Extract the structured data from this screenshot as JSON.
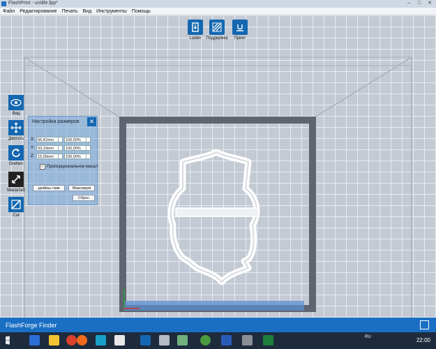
{
  "window": {
    "title": "FlashPrint - untitle.fpp*",
    "controls": [
      "–",
      "□",
      "✕"
    ]
  },
  "menu": [
    "Файл",
    "Редактирование",
    "Печать",
    "Вид",
    "Инструменты",
    "Помощь"
  ],
  "top_tools": [
    {
      "label": "Laden",
      "icon": "load-icon"
    },
    {
      "label": "Поддержка",
      "icon": "support-icon"
    },
    {
      "label": "Принт",
      "icon": "print-icon"
    }
  ],
  "side_tools": [
    {
      "label": "Вид",
      "icon": "eye-icon"
    },
    {
      "label": "Двигать",
      "icon": "move-icon"
    },
    {
      "label": "Drehen",
      "icon": "rotate-icon"
    },
    {
      "label": "Масштаб",
      "icon": "scale-icon",
      "active": true
    },
    {
      "label": "Cut",
      "icon": "cut-icon"
    }
  ],
  "scale_panel": {
    "title": "Настройка размеров",
    "close": "✕",
    "rows": [
      {
        "axis": "X:",
        "size": "66,41mm",
        "percent": "100,00%"
      },
      {
        "axis": "Y:",
        "size": "93,19mm",
        "percent": "100,00%"
      },
      {
        "axis": "Z:",
        "size": "15,00mm",
        "percent": "100,00%"
      }
    ],
    "checkbox_mark": "✓",
    "checkbox_label": "Пропорциональное масшт",
    "inches_button": "дюймы->мм",
    "max_button": "Максимум",
    "reset_button": "Сброс"
  },
  "status": {
    "text": "FlashForge Finder"
  },
  "taskbar": {
    "lang": "RU",
    "clock": "22:00"
  },
  "colors": {
    "accent": "#1467b0",
    "status_bar": "#1a6fc4",
    "build_frame": "#5e6570",
    "model": "#ffffff"
  }
}
